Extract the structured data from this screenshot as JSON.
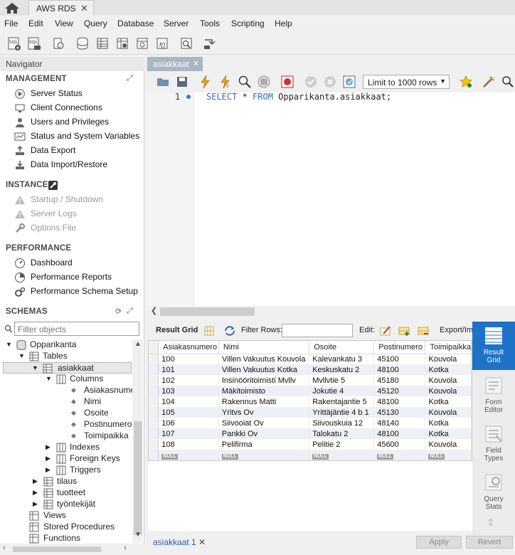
{
  "title_bar": {
    "home_icon": "home-icon",
    "connection_tab": "AWS RDS"
  },
  "menu": [
    "File",
    "Edit",
    "View",
    "Query",
    "Database",
    "Server",
    "Tools",
    "Scripting",
    "Help"
  ],
  "navigator": {
    "header": "Navigator",
    "management": {
      "title": "MANAGEMENT",
      "items": [
        "Server Status",
        "Client Connections",
        "Users and Privileges",
        "Status and System Variables",
        "Data Export",
        "Data Import/Restore"
      ]
    },
    "instance": {
      "title": "INSTANCE",
      "items": [
        "Startup / Shutdown",
        "Server Logs",
        "Options File"
      ]
    },
    "performance": {
      "title": "PERFORMANCE",
      "items": [
        "Dashboard",
        "Performance Reports",
        "Performance Schema Setup"
      ]
    },
    "schemas": {
      "title": "SCHEMAS",
      "filter_placeholder": "Filter objects",
      "tree": {
        "schema": "Opparikanta",
        "tables": "Tables",
        "selected_table": "asiakkaat",
        "columns": "Columns",
        "column_list": [
          "Asiakasnumero",
          "Nimi",
          "Osoite",
          "Postinumero",
          "Toimipaikka"
        ],
        "indexes": "Indexes",
        "foreign_keys": "Foreign Keys",
        "triggers": "Triggers",
        "other_tables": [
          "tilaus",
          "tuotteet",
          "työntekijät"
        ],
        "views": "Views",
        "stored_procedures": "Stored Procedures",
        "functions": "Functions"
      }
    }
  },
  "query_tab": {
    "label": "asiakkaat"
  },
  "query_toolbar": {
    "limit": "Limit to 1000 rows"
  },
  "editor": {
    "line": "1",
    "sql_select": "SELECT",
    "sql_star": " * ",
    "sql_from": "FROM",
    "sql_rest": " Opparikanta.asiakkaat;"
  },
  "result_toolbar": {
    "result_grid": "Result Grid",
    "filter_rows": "Filter Rows:",
    "edit": "Edit:",
    "export": "Export/Import:"
  },
  "grid": {
    "columns": [
      "Asiakasnumero",
      "Nimi",
      "Osoite",
      "Postinumero",
      "Toimipaikka"
    ],
    "rows": [
      [
        "100",
        "Villen Vakuutus Kouvola",
        "Kalevankatu 3",
        "45100",
        "Kouvola"
      ],
      [
        "101",
        "Villen Vakuutus Kotka",
        "Keskuskatu 2",
        "48100",
        "Kotka"
      ],
      [
        "102",
        "Insinööritoimisti Mvllv",
        "Mvllvtie 5",
        "45180",
        "Kouvola"
      ],
      [
        "103",
        "Mäkitoimisto",
        "Jokutie 4",
        "45120",
        "Kouvola"
      ],
      [
        "104",
        "Rakennus Matti",
        "Rakentajantie 5",
        "48100",
        "Kotka"
      ],
      [
        "105",
        "Yritvs Ov",
        "Yrittäjäntie 4 b 1",
        "45130",
        "Kouvola"
      ],
      [
        "106",
        "Siivooiat Ov",
        "Siivouskuia 12",
        "48140",
        "Kotka"
      ],
      [
        "107",
        "Pankki Ov",
        "Talokatu 2",
        "48100",
        "Kotka"
      ],
      [
        "108",
        "Pelifirma",
        "Pelitie 2",
        "45600",
        "Kouvola"
      ]
    ],
    "null_label": "NULL"
  },
  "right_sidebar": {
    "result_grid_1": "Result",
    "result_grid_2": "Grid",
    "form_editor_1": "Form",
    "form_editor_2": "Editor",
    "field_types_1": "Field",
    "field_types_2": "Types",
    "query_stats_1": "Query",
    "query_stats_2": "Stats"
  },
  "bottom": {
    "tab": "asiakkaat 1",
    "apply": "Apply",
    "revert": "Revert"
  },
  "colors": {
    "accent": "#1e73c8",
    "query_tab": "#a9b6c3",
    "keyword": "#3a6ab8"
  }
}
